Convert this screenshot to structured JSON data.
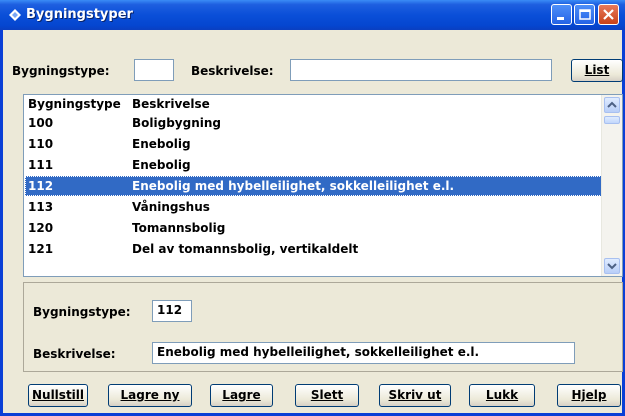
{
  "window": {
    "title": "Bygningstyper",
    "titlebar_color": "#0a4fd8",
    "selection_color": "#316ac5"
  },
  "filter": {
    "type_label": "Bygningstype:",
    "type_value": "",
    "desc_label": "Beskrivelse:",
    "desc_value": "",
    "list_button": "List"
  },
  "list": {
    "columns": [
      "Bygningstype",
      "Beskrivelse"
    ],
    "rows": [
      {
        "code": "100",
        "desc": "Boligbygning"
      },
      {
        "code": "110",
        "desc": "Enebolig"
      },
      {
        "code": "111",
        "desc": "Enebolig"
      },
      {
        "code": "112",
        "desc": "Enebolig med hybelleilighet, sokkelleilighet e.l.",
        "selected": true
      },
      {
        "code": "113",
        "desc": "Våningshus"
      },
      {
        "code": "120",
        "desc": "Tomannsbolig"
      },
      {
        "code": "121",
        "desc": "Del av tomannsbolig, vertikaldelt"
      }
    ]
  },
  "detail": {
    "type_label": "Bygningstype:",
    "type_value": "112",
    "desc_label": "Beskrivelse:",
    "desc_value": "Enebolig med hybelleilighet, sokkelleilighet e.l."
  },
  "buttons": {
    "nullstill": "Nullstill",
    "lagre_ny": "Lagre ny",
    "lagre": "Lagre",
    "slett": "Slett",
    "skriv_ut": "Skriv ut",
    "lukk": "Lukk",
    "hjelp": "Hjelp"
  },
  "icons": [
    "app-icon",
    "minimize-icon",
    "maximize-icon",
    "close-icon",
    "scroll-up-icon",
    "scroll-down-icon"
  ]
}
